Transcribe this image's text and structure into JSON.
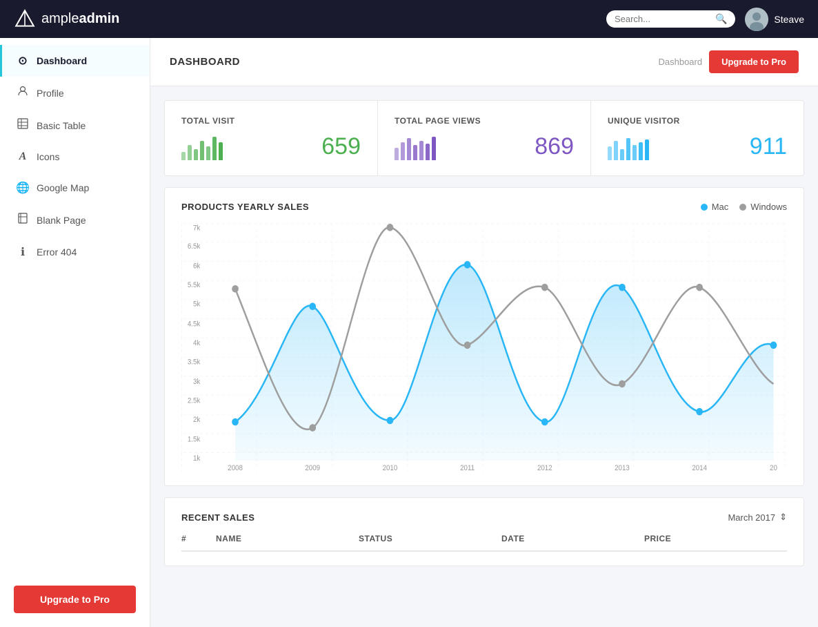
{
  "app": {
    "name_prefix": "ample",
    "name_suffix": "admin"
  },
  "topnav": {
    "search_placeholder": "Search...",
    "user_name": "Steave"
  },
  "sidebar": {
    "items": [
      {
        "id": "dashboard",
        "label": "Dashboard",
        "icon": "⊙",
        "active": true
      },
      {
        "id": "profile",
        "label": "Profile",
        "icon": "👤",
        "active": false
      },
      {
        "id": "basic-table",
        "label": "Basic Table",
        "icon": "⊞",
        "active": false
      },
      {
        "id": "icons",
        "label": "Icons",
        "icon": "A",
        "active": false
      },
      {
        "id": "google-map",
        "label": "Google Map",
        "icon": "🌐",
        "active": false
      },
      {
        "id": "blank-page",
        "label": "Blank Page",
        "icon": "⊡",
        "active": false
      },
      {
        "id": "error-404",
        "label": "Error 404",
        "icon": "ℹ",
        "active": false
      }
    ],
    "upgrade_label": "Upgrade to Pro"
  },
  "header": {
    "title": "DASHBOARD",
    "breadcrumb": "Dashboard",
    "upgrade_label": "Upgrade to Pro"
  },
  "stats": [
    {
      "label": "TOTAL VISIT",
      "value": "659",
      "color": "#4caf50",
      "bars": [
        30,
        55,
        40,
        70,
        50,
        80,
        60
      ]
    },
    {
      "label": "TOTAL PAGE VIEWS",
      "value": "869",
      "color": "#7e57c2",
      "bars": [
        45,
        65,
        80,
        55,
        70,
        60,
        85
      ]
    },
    {
      "label": "UNIQUE VISITOR",
      "value": "911",
      "color": "#29b6f6",
      "bars": [
        50,
        70,
        40,
        80,
        55,
        65,
        75
      ]
    }
  ],
  "chart": {
    "title": "PRODUCTS YEARLY SALES",
    "legend": [
      {
        "label": "Mac",
        "color": "#29b6f6"
      },
      {
        "label": "Windows",
        "color": "#9e9e9e"
      }
    ],
    "x_labels": [
      "2008",
      "2009",
      "2010",
      "2011",
      "2012",
      "2013",
      "2014",
      "20"
    ],
    "y_labels": [
      "1k",
      "1.5k",
      "2k",
      "2.5k",
      "3k",
      "3.5k",
      "4k",
      "4.5k",
      "5k",
      "5.5k",
      "6k",
      "6.5k",
      "7k"
    ]
  },
  "recent_sales": {
    "title": "RECENT SALES",
    "month": "March 2017",
    "columns": [
      "#",
      "NAME",
      "STATUS",
      "DATE",
      "PRICE"
    ]
  }
}
